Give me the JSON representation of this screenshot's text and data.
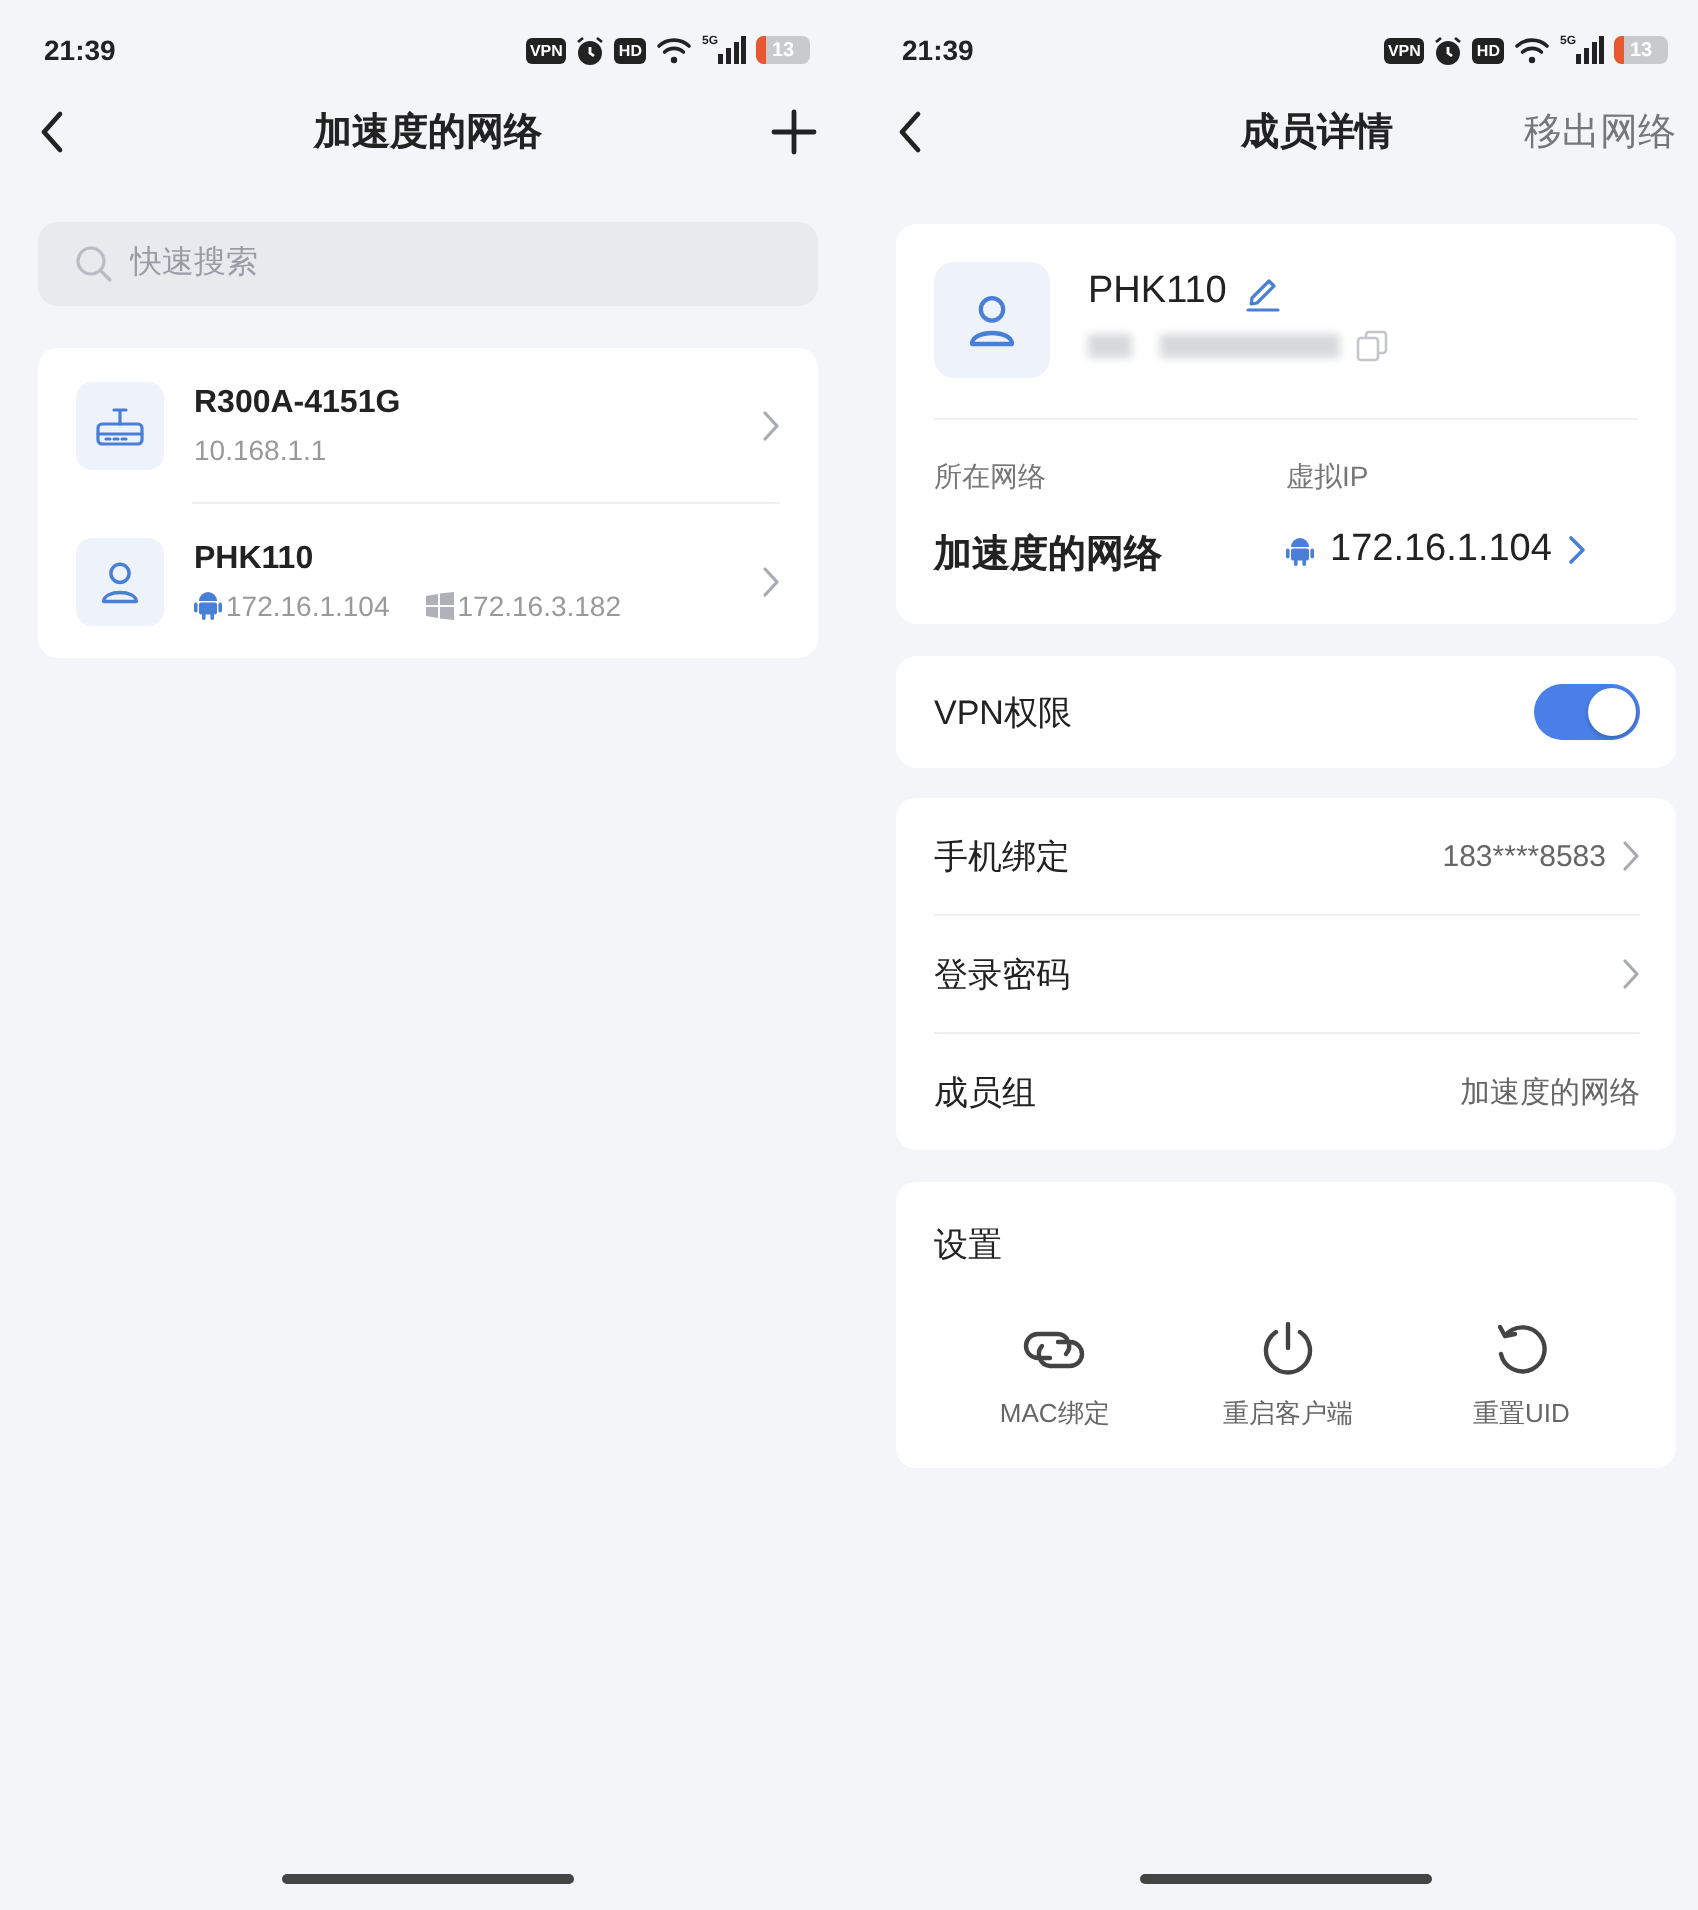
{
  "list_screen": {
    "status_bar": {
      "time": "21:39",
      "vpn_badge": "VPN",
      "hd_badge": "HD",
      "network_type": "5G",
      "battery": "13"
    },
    "header": {
      "title": "加速度的网络"
    },
    "search": {
      "placeholder": "快速搜索"
    },
    "devices": [
      {
        "kind": "router",
        "name": "R300A-4151G",
        "addresses": [
          {
            "kind": "plain",
            "text": "10.168.1.1"
          }
        ]
      },
      {
        "kind": "member",
        "name": "PHK110",
        "addresses": [
          {
            "kind": "android",
            "text": "172.16.1.104"
          },
          {
            "kind": "windows",
            "text": "172.16.3.182"
          }
        ]
      }
    ]
  },
  "detail_screen": {
    "status_bar": {
      "time": "21:39",
      "vpn_badge": "VPN",
      "hd_badge": "HD",
      "network_type": "5G",
      "battery": "13"
    },
    "header": {
      "title": "成员详情",
      "action": "移出网络"
    },
    "member": {
      "name": "PHK110",
      "network_label": "所在网络",
      "network": "加速度的网络",
      "ip_label": "虚拟IP",
      "ip": {
        "kind": "android",
        "text": "172.16.1.104"
      }
    },
    "vpn": {
      "label": "VPN权限",
      "on": true
    },
    "info_rows": [
      {
        "label": "手机绑定",
        "value": "183****8583",
        "chevron": true
      },
      {
        "label": "登录密码",
        "chevron": true
      },
      {
        "label": "成员组",
        "value": "加速度的网络",
        "chevron": false
      }
    ],
    "settings": {
      "title": "设置",
      "actions": [
        {
          "kind": "link",
          "label": "MAC绑定"
        },
        {
          "kind": "power",
          "label": "重启客户端"
        },
        {
          "kind": "reset",
          "label": "重置UID"
        }
      ]
    }
  }
}
